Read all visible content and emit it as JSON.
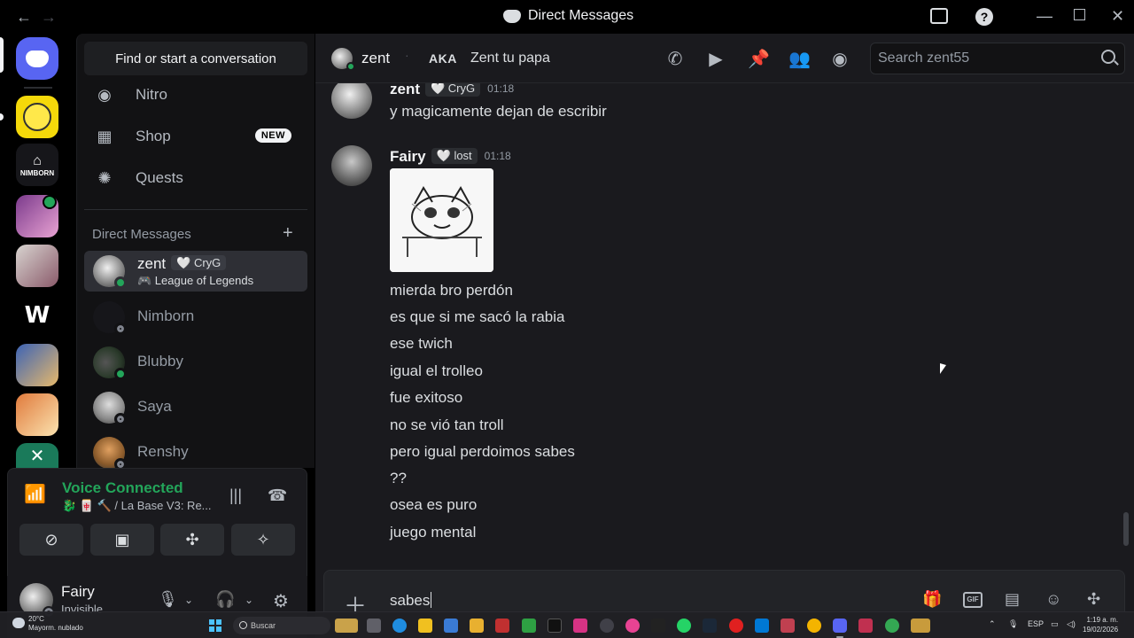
{
  "window": {
    "title": "Direct Messages",
    "back_icon": "arrow-left-icon",
    "forward_icon": "arrow-right-icon"
  },
  "servers": [
    {
      "name": "home",
      "icon": "discord-logo-icon",
      "color": "#5865f2"
    },
    {
      "name": "server-yellow",
      "color": "#f5d90a"
    },
    {
      "name": "NIMBORN",
      "color": "#16161a"
    },
    {
      "name": "server-purple",
      "color": "#7b3a8c"
    },
    {
      "name": "server-white",
      "color": "#d8d4d0"
    },
    {
      "name": "W",
      "color": "#000000"
    },
    {
      "name": "server-blue",
      "color": "#3c63b5"
    },
    {
      "name": "server-orange",
      "color": "#e07a3c"
    },
    {
      "name": "V",
      "color": "#1a7a5a"
    }
  ],
  "dm_sidebar": {
    "search_label": "Find or start a conversation",
    "nav": [
      {
        "label": "Nitro",
        "icon": "nitro-icon"
      },
      {
        "label": "Shop",
        "icon": "shop-icon",
        "badge": "NEW"
      },
      {
        "label": "Quests",
        "icon": "quests-icon"
      }
    ],
    "section_title": "Direct Messages",
    "add_label": "+",
    "conversations": [
      {
        "name": "zent",
        "tag": "🤍 CryG",
        "activity": "🎮 League of Legends",
        "status": "online",
        "active": true
      },
      {
        "name": "Nimborn",
        "status": "offline"
      },
      {
        "name": "Blubby",
        "status": "online"
      },
      {
        "name": "Saya",
        "status": "offline"
      },
      {
        "name": "Renshy",
        "status": "offline"
      }
    ]
  },
  "voice": {
    "title": "Voice Connected",
    "channel": "🐉 🀄 🔨 / La Base V3: Re...",
    "buttons": [
      "camera-off-icon",
      "screen-share-icon",
      "activities-icon",
      "soundboard-icon"
    ]
  },
  "user_panel": {
    "name": "Fairy",
    "status": "Invisible"
  },
  "chat_header": {
    "name": "zent",
    "dot": "·",
    "aka_label": "AKA",
    "aka_value": "Zent tu papa",
    "search_placeholder": "Search zent55"
  },
  "messages": [
    {
      "author": "zent",
      "tag": "🤍 CryG",
      "time": "01:18",
      "lines": [
        "y magicamente dejan de escribir"
      ]
    },
    {
      "author": "Fairy",
      "tag": "🤍 lost",
      "time": "01:18",
      "has_image": true,
      "lines": [
        "mierda bro perdón",
        "es que si me sacó la rabia",
        "ese twich",
        "igual el trolleo",
        "fue exitoso",
        "no se vió tan troll",
        "pero igual perdoimos sabes",
        "??",
        "osea es puro",
        "juego mental"
      ]
    }
  ],
  "composer": {
    "value": "sabes",
    "gif_label": "GIF"
  },
  "taskbar": {
    "weather_temp": "20°C",
    "weather_desc": "Mayorm. nublado",
    "search_label": "Buscar",
    "lang": "ESP",
    "time": "1:19 a. m.",
    "date": "19/02/2026"
  }
}
